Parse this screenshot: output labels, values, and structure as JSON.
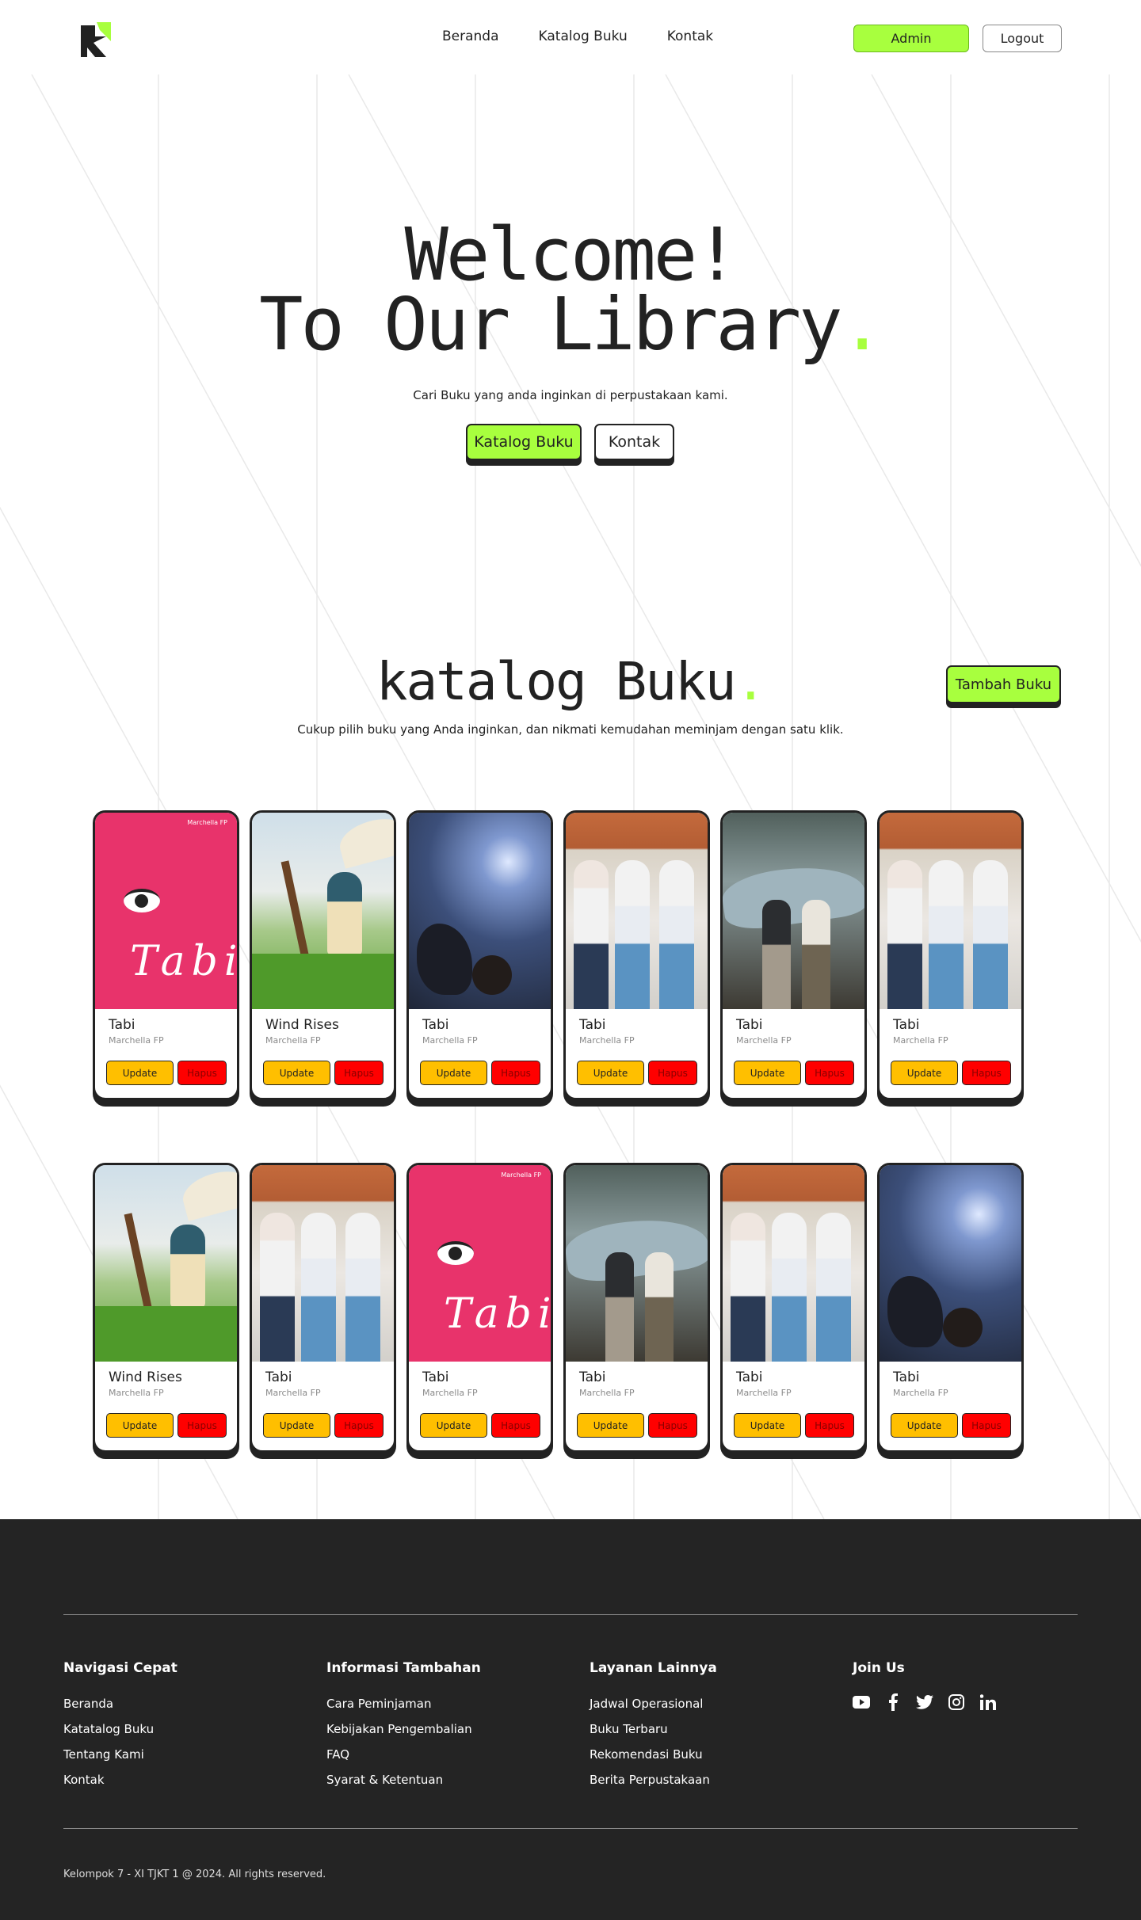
{
  "header": {
    "nav": [
      "Beranda",
      "Katalog Buku",
      "Kontak"
    ],
    "admin_label": "Admin",
    "logout_label": "Logout"
  },
  "hero": {
    "line1": "Welcome!",
    "line2": "To Our Library",
    "dot": ".",
    "subtitle": "Cari Buku yang anda inginkan di perpustakaan kami.",
    "btn_katalog": "Katalog Buku",
    "btn_kontak": "Kontak"
  },
  "katalog": {
    "title": "katalog Buku",
    "dot": ".",
    "subtitle": "Cukup pilih buku yang Anda inginkan, dan nikmati kemudahan meminjam dengan satu klik.",
    "add_button": "Tambah Buku",
    "update_label": "Update",
    "delete_label": "Hapus",
    "row1": [
      {
        "title": "Tabi",
        "author": "Marchella FP",
        "cover": "tabi"
      },
      {
        "title": "Wind Rises",
        "author": "Marchella FP",
        "cover": "wind"
      },
      {
        "title": "Tabi",
        "author": "Marchella FP",
        "cover": "fight"
      },
      {
        "title": "Tabi",
        "author": "Marchella FP",
        "cover": "school"
      },
      {
        "title": "Tabi",
        "author": "Marchella FP",
        "cover": "plane"
      },
      {
        "title": "Tabi",
        "author": "Marchella FP",
        "cover": "school"
      }
    ],
    "row2": [
      {
        "title": "Wind Rises",
        "author": "Marchella FP",
        "cover": "wind"
      },
      {
        "title": "Tabi",
        "author": "Marchella FP",
        "cover": "school"
      },
      {
        "title": "Tabi",
        "author": "Marchella FP",
        "cover": "tabi"
      },
      {
        "title": "Tabi",
        "author": "Marchella FP",
        "cover": "plane"
      },
      {
        "title": "Tabi",
        "author": "Marchella FP",
        "cover": "school"
      },
      {
        "title": "Tabi",
        "author": "Marchella FP",
        "cover": "fight"
      }
    ],
    "tabi_cover_text": "Tabi",
    "tabi_cover_author": "Marchella FP"
  },
  "footer": {
    "col1": {
      "title": "Navigasi Cepat",
      "links": [
        "Beranda",
        "Katatalog Buku",
        "Tentang Kami",
        "Kontak"
      ]
    },
    "col2": {
      "title": "Informasi Tambahan",
      "links": [
        "Cara Peminjaman",
        "Kebijakan Pengembalian",
        "FAQ",
        "Syarat & Ketentuan"
      ]
    },
    "col3": {
      "title": "Layanan Lainnya",
      "links": [
        "Jadwal Operasional",
        "Buku Terbaru",
        "Rekomendasi Buku",
        "Berita Perpustakaan"
      ]
    },
    "col4": {
      "title": "Join Us",
      "icons": [
        "youtube-icon",
        "facebook-icon",
        "twitter-icon",
        "instagram-icon",
        "linkedin-icon"
      ]
    },
    "copyright": "Kelompok 7 - XI TJKT 1 @ 2024. All rights reserved."
  },
  "colors": {
    "accent": "#a8ff3e",
    "update": "#ffbf00",
    "delete": "#ff0000",
    "footer_bg": "#242424"
  }
}
